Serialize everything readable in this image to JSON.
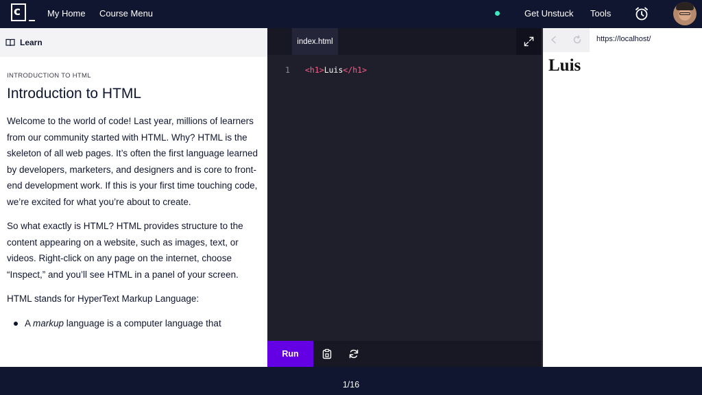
{
  "nav": {
    "my_home": "My Home",
    "course_menu": "Course Menu",
    "get_unstuck": "Get Unstuck",
    "tools": "Tools",
    "status_color": "#3ee8c1"
  },
  "learn": {
    "header_label": "Learn",
    "breadcrumb": "INTRODUCTION TO HTML",
    "title": "Introduction to HTML",
    "paragraphs": [
      "Welcome to the world of code! Last year, millions of learners from our community started with HTML. Why? HTML is the skeleton of all web pages. It’s often the first language learned by developers, marketers, and designers and is core to front-end development work. If this is your first time touching code, we’re excited for what you’re about to create.",
      "So what exactly is HTML? HTML provides structure to the content appearing on a website, such as images, text, or videos. Right-click on any page on the internet, choose “Inspect,” and you’ll see HTML in a panel of your screen.",
      "HTML stands for HyperText Markup Language:"
    ],
    "bullet_pre": "A ",
    "bullet_em": "markup",
    "bullet_post": " language is a computer language that"
  },
  "editor": {
    "tab_label": "index.html",
    "line_number": "1",
    "code_open_tag": "<h1>",
    "code_text": "Luis",
    "code_close_tag": "</h1>",
    "run_label": "Run"
  },
  "browser": {
    "url": "https://localhost/",
    "rendered_heading": "Luis"
  },
  "footer": {
    "pager": "1/16"
  },
  "icons": {
    "logo": "codecademy-logo",
    "alarm": "alarm-clock-icon",
    "expand": "expand-icon",
    "copy": "clipboard-icon",
    "reset": "refresh-icon",
    "back": "back-arrow-icon",
    "reload": "reload-icon",
    "book": "book-icon"
  },
  "colors": {
    "nav_bg": "#10162f",
    "run_button": "#6400e4",
    "tag_color": "#ff5c8a"
  }
}
